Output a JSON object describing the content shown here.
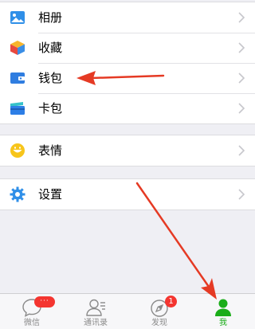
{
  "menu": {
    "group1": [
      {
        "label": "相册",
        "icon": "photo-album-icon"
      },
      {
        "label": "收藏",
        "icon": "favorites-cube-icon"
      },
      {
        "label": "钱包",
        "icon": "wallet-icon"
      },
      {
        "label": "卡包",
        "icon": "card-pack-icon"
      }
    ],
    "group2": [
      {
        "label": "表情",
        "icon": "smiley-icon"
      }
    ],
    "group3": [
      {
        "label": "设置",
        "icon": "gear-icon"
      }
    ]
  },
  "tabbar": {
    "tabs": [
      {
        "label": "微信",
        "icon": "chat-bubble-icon",
        "badge": "···"
      },
      {
        "label": "通讯录",
        "icon": "contacts-icon"
      },
      {
        "label": "发现",
        "icon": "compass-icon",
        "badge": "1"
      },
      {
        "label": "我",
        "icon": "person-icon",
        "active": true
      }
    ]
  },
  "colors": {
    "accent_green": "#1aad19",
    "badge_red": "#f43530",
    "annotation_arrow": "#e53a24",
    "background": "#efeff4"
  },
  "annotations": [
    {
      "type": "arrow",
      "points_to": "钱包"
    },
    {
      "type": "arrow",
      "points_to": "我"
    }
  ]
}
